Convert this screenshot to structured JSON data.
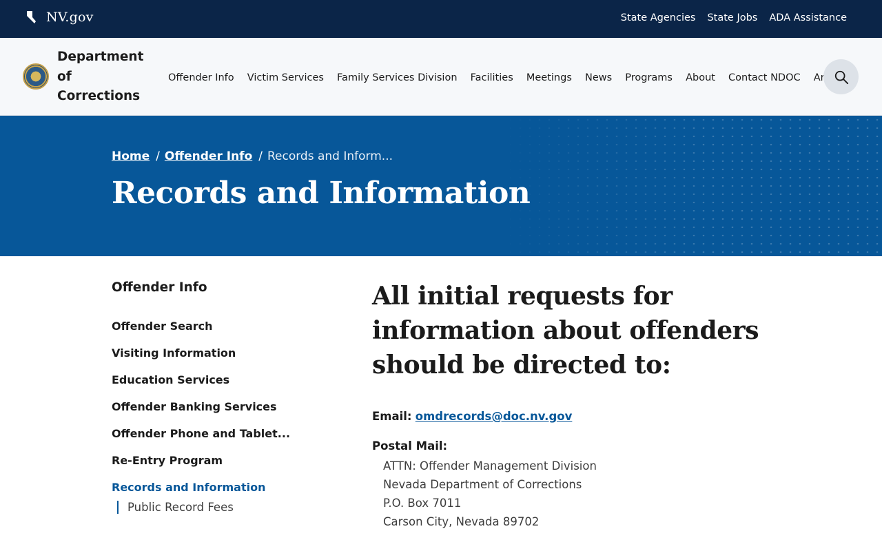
{
  "topbar": {
    "brand": "NV.gov",
    "links": [
      "State Agencies",
      "State Jobs",
      "ADA Assistance"
    ]
  },
  "header": {
    "org_name": "Department of Corrections",
    "nav": [
      "Offender Info",
      "Victim Services",
      "Family Services Division",
      "Facilities",
      "Meetings",
      "News",
      "Programs",
      "About",
      "Contact NDOC",
      "Archive"
    ]
  },
  "hero": {
    "breadcrumb": {
      "home": "Home",
      "parent": "Offender Info",
      "current": "Records and Inform..."
    },
    "title": "Records and Information"
  },
  "sidebar": {
    "heading": "Offender Info",
    "items": [
      {
        "label": "Offender Search"
      },
      {
        "label": "Visiting Information"
      },
      {
        "label": "Education Services"
      },
      {
        "label": "Offender Banking Services"
      },
      {
        "label": "Offender Phone and Tablet..."
      },
      {
        "label": "Re-Entry Program"
      },
      {
        "label": "Records and Information"
      }
    ],
    "sub_item": "Public Record Fees"
  },
  "main": {
    "heading": "All initial requests for information about offenders should be directed to:",
    "email_label": "Email:",
    "email": "omdrecords@doc.nv.gov",
    "postal_label": "Postal Mail:",
    "address": [
      "ATTN: Offender Management Division",
      "Nevada Department of Corrections",
      "P.O. Box 7011",
      "Carson City, Nevada 89702"
    ]
  },
  "colors": {
    "topbar": "#0b2548",
    "hero": "#075799",
    "active_link": "#075799"
  }
}
